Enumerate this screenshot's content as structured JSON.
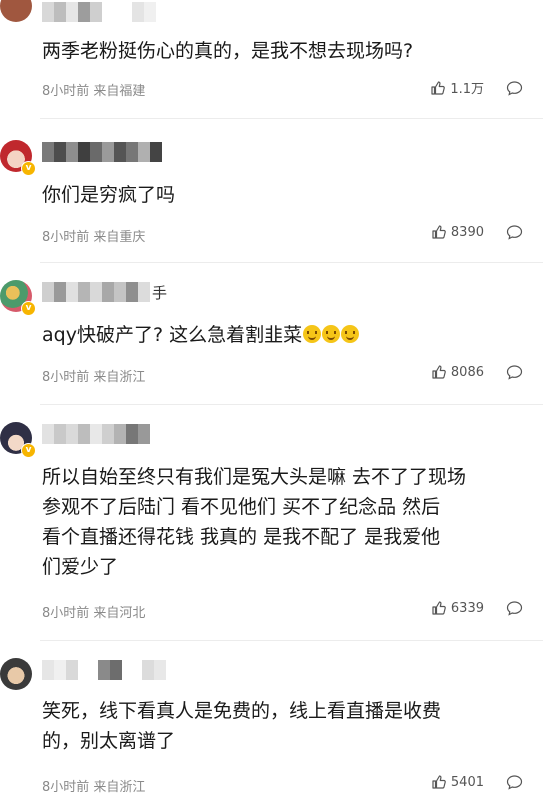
{
  "comments": [
    {
      "username_tail": "",
      "text": "两季老粉挺伤心的真的，是我不想去现场吗?",
      "time": "8小时前",
      "location": "来自福建",
      "likes": "1.1万"
    },
    {
      "username_tail": "",
      "text": "你们是穷疯了吗",
      "time": "8小时前",
      "location": "来自重庆",
      "likes": "8390"
    },
    {
      "username_tail": "手",
      "text": "aqy快破产了? 这么急着割韭菜",
      "time": "8小时前",
      "location": "来自浙江",
      "likes": "8086"
    },
    {
      "username_tail": "",
      "text": "所以自始至终只有我们是冤大头是嘛 去不了了现场\n参观不了后陆门 看不见他们 买不了纪念品 然后\n看个直播还得花钱 我真的 是我不配了 是我爱他\n们爱少了",
      "time": "8小时前",
      "location": "来自河北",
      "likes": "6339"
    },
    {
      "username_tail": "",
      "text": "笑死，线下看真人是免费的，线上看直播是收费\n的，别太离谱了",
      "time": "8小时前",
      "location": "来自浙江",
      "likes": "5401"
    }
  ]
}
